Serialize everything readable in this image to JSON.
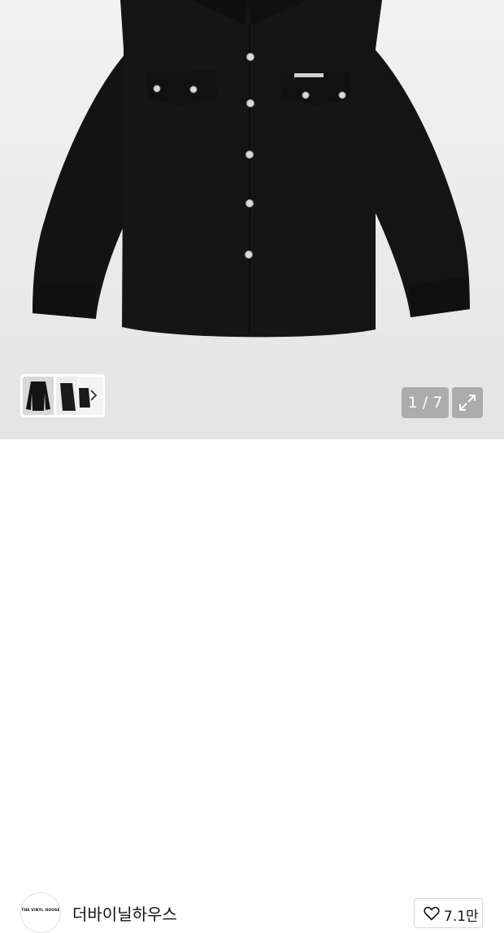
{
  "product_image": {
    "alt_name": "black-western-shirt"
  },
  "gallery": {
    "counter": "1 / 7",
    "next_icon": "chevron-right-icon",
    "expand_icon": "expand-icon"
  },
  "shop": {
    "name": "더바이닐하우스",
    "avatar_text": "THE VINYL HOUSE"
  },
  "like": {
    "icon": "heart-icon",
    "count": "7.1만"
  },
  "colors": {
    "hero_bg": "#ececec",
    "overlay": "#969696",
    "text": "#111111"
  }
}
